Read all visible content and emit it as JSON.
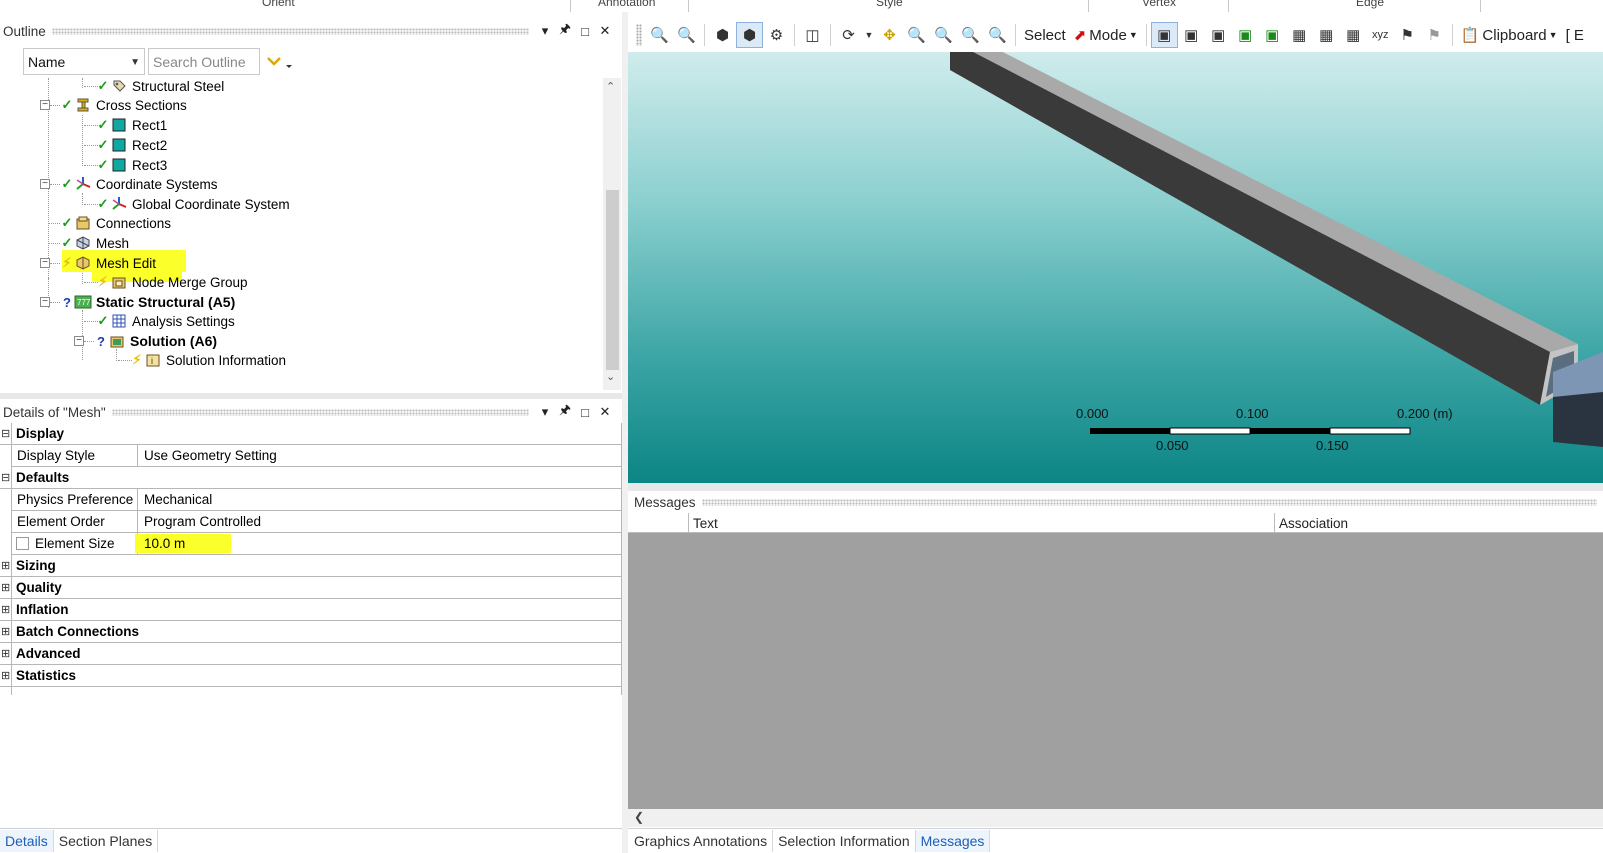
{
  "ribbon": {
    "groups": [
      "Orient",
      "Annotation",
      "Style",
      "Vertex",
      "Edge"
    ]
  },
  "outline": {
    "title": "Outline",
    "filter_field": "Name",
    "search_placeholder": "Search Outline",
    "tree": [
      {
        "label": "Structural Steel",
        "status": "ok",
        "icon": "material-icon"
      },
      {
        "label": "Cross Sections",
        "status": "ok",
        "icon": "cross-section-icon",
        "expander": "minus"
      },
      {
        "label": "Rect1",
        "status": "ok",
        "icon": "rect-section-icon"
      },
      {
        "label": "Rect2",
        "status": "ok",
        "icon": "rect-section-icon"
      },
      {
        "label": "Rect3",
        "status": "ok",
        "icon": "rect-section-icon"
      },
      {
        "label": "Coordinate Systems",
        "status": "ok",
        "icon": "coordinate-systems-icon",
        "expander": "minus"
      },
      {
        "label": "Global Coordinate System",
        "status": "ok",
        "icon": "coordinate-system-icon"
      },
      {
        "label": "Connections",
        "status": "ok",
        "icon": "connections-icon"
      },
      {
        "label": "Mesh",
        "status": "ok",
        "icon": "mesh-icon"
      },
      {
        "label": "Mesh Edit",
        "status": "lightning",
        "icon": "mesh-edit-icon",
        "expander": "minus",
        "highlighted": true
      },
      {
        "label": "Node Merge Group",
        "status": "lightning",
        "icon": "node-merge-icon",
        "highlighted_partial": true
      },
      {
        "label": "Static Structural (A5)",
        "status": "question",
        "icon": "static-structural-icon",
        "expander": "minus",
        "bold": true
      },
      {
        "label": "Analysis Settings",
        "status": "ok",
        "icon": "analysis-settings-icon"
      },
      {
        "label": "Solution (A6)",
        "status": "question",
        "icon": "solution-icon",
        "expander": "minus",
        "bold": true
      },
      {
        "label": "Solution Information",
        "status": "lightning",
        "icon": "solution-information-icon"
      }
    ]
  },
  "details": {
    "title": "Details of \"Mesh\"",
    "groups": {
      "display": "Display",
      "defaults": "Defaults",
      "sizing": "Sizing",
      "quality": "Quality",
      "inflation": "Inflation",
      "batch_connections": "Batch Connections",
      "advanced": "Advanced",
      "statistics": "Statistics"
    },
    "props": {
      "display_style": {
        "key": "Display Style",
        "value": "Use Geometry Setting"
      },
      "physics_preference": {
        "key": "Physics Preference",
        "value": "Mechanical"
      },
      "element_order": {
        "key": "Element Order",
        "value": "Program Controlled"
      },
      "element_size": {
        "key": "Element Size",
        "value": "10.0 m"
      }
    }
  },
  "left_tabs": [
    "Details",
    "Section Planes"
  ],
  "toolbar": {
    "select_label": "Select",
    "mode_label": "Mode",
    "clipboard_label": "Clipboard",
    "truncated_label": "[ E"
  },
  "viewport": {
    "scale": {
      "top_labels": [
        "0.000",
        "0.100",
        "0.200 (m)"
      ],
      "bottom_labels": [
        "0.050",
        "0.150"
      ]
    }
  },
  "messages": {
    "title": "Messages",
    "col_text": "Text",
    "col_association": "Association"
  },
  "right_tabs": [
    "Graphics Annotations",
    "Selection Information",
    "Messages"
  ],
  "colors": {
    "highlight": "#fbff2a",
    "check_green": "#1a9a1a",
    "question_blue": "#1a3cb0",
    "lightning_yellow": "#e5c100",
    "active_tab": "#1b5fb8"
  }
}
